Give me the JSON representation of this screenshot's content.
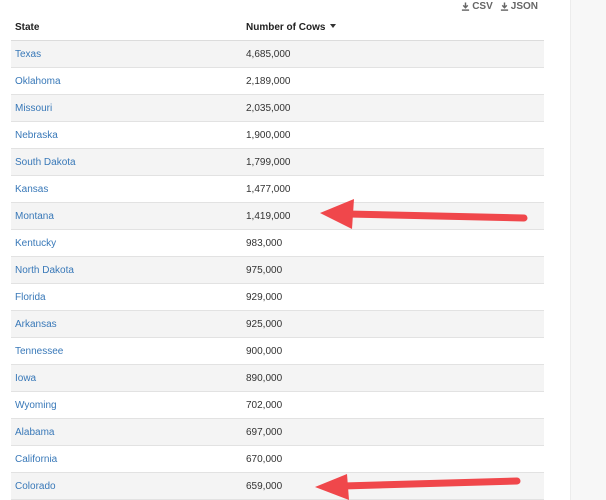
{
  "export": {
    "csv_label": "CSV",
    "json_label": "JSON"
  },
  "table": {
    "headers": {
      "state": "State",
      "cows": "Number of Cows"
    },
    "rows": [
      {
        "state": "Texas",
        "cows": "4,685,000"
      },
      {
        "state": "Oklahoma",
        "cows": "2,189,000"
      },
      {
        "state": "Missouri",
        "cows": "2,035,000"
      },
      {
        "state": "Nebraska",
        "cows": "1,900,000"
      },
      {
        "state": "South Dakota",
        "cows": "1,799,000"
      },
      {
        "state": "Kansas",
        "cows": "1,477,000"
      },
      {
        "state": "Montana",
        "cows": "1,419,000"
      },
      {
        "state": "Kentucky",
        "cows": "983,000"
      },
      {
        "state": "North Dakota",
        "cows": "975,000"
      },
      {
        "state": "Florida",
        "cows": "929,000"
      },
      {
        "state": "Arkansas",
        "cows": "925,000"
      },
      {
        "state": "Tennessee",
        "cows": "900,000"
      },
      {
        "state": "Iowa",
        "cows": "890,000"
      },
      {
        "state": "Wyoming",
        "cows": "702,000"
      },
      {
        "state": "Alabama",
        "cows": "697,000"
      },
      {
        "state": "California",
        "cows": "670,000"
      },
      {
        "state": "Colorado",
        "cows": "659,000"
      }
    ]
  },
  "colors": {
    "link": "#3878b8",
    "arrow": "#f0474b",
    "row_stripe": "#f4f4f4"
  },
  "annotations": {
    "arrow_icon": "red-arrow-left",
    "highlighted_states": [
      "Montana",
      "Colorado"
    ]
  }
}
